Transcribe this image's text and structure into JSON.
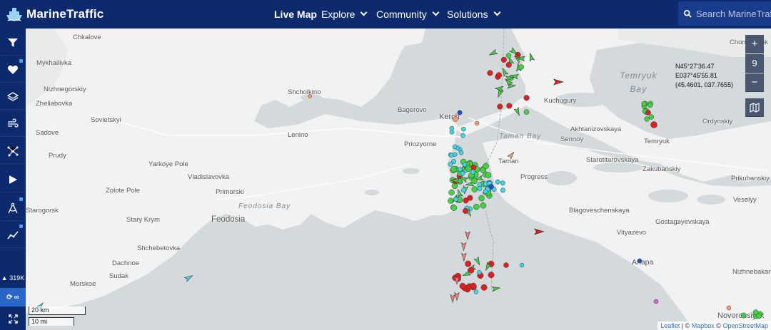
{
  "brand": {
    "name": "MarineTraffic"
  },
  "nav": {
    "live_map": "Live Map",
    "explore": "Explore",
    "community": "Community",
    "solutions": "Solutions"
  },
  "search": {
    "placeholder": "Search MarineTraffic"
  },
  "sidebar": {
    "items": [
      {
        "icon": "filter-icon"
      },
      {
        "icon": "heart-icon"
      },
      {
        "icon": "layers-icon"
      },
      {
        "icon": "wind-icon"
      },
      {
        "icon": "network-icon"
      },
      {
        "icon": "play-icon"
      },
      {
        "icon": "compass-icon"
      },
      {
        "icon": "chart-icon"
      }
    ],
    "vessel_count": "319K",
    "live_label": "∞",
    "expand_icon": "expand-icon"
  },
  "map": {
    "zoom": "9",
    "coordinates": {
      "lat": "N45°27'36.47",
      "lon": "E037°45'55.81",
      "decimal": "(45.4601, 037.7655)"
    },
    "scale": {
      "km": "20 km",
      "mi": "10 mi"
    },
    "attribution": {
      "leaflet": "Leaflet",
      "mapbox": "Mapbox",
      "osm": "OpenStreetMap",
      "sep": "|",
      "copy": "©"
    },
    "places": [
      {
        "name": "Chkalove"
      },
      {
        "name": "Mykhailivka"
      },
      {
        "name": "Nizhnegorskiy"
      },
      {
        "name": "Zheliabovka"
      },
      {
        "name": "Sovietskyi"
      },
      {
        "name": "Sadove"
      },
      {
        "name": "Prudy"
      },
      {
        "name": "Yarkoye Pole"
      },
      {
        "name": "Vladislavovka"
      },
      {
        "name": "Zolote Pole"
      },
      {
        "name": "Primorski"
      },
      {
        "name": "Lenino"
      },
      {
        "name": "Feodosia"
      },
      {
        "name": "Stary Krym"
      },
      {
        "name": "Shchebetovka"
      },
      {
        "name": "Dachnoe"
      },
      {
        "name": "Sudak"
      },
      {
        "name": "Morskoe"
      },
      {
        "name": "Shcholkino"
      },
      {
        "name": "Bagerovo"
      },
      {
        "name": "Kerch"
      },
      {
        "name": "Priozyorne"
      },
      {
        "name": "Kuchugury"
      },
      {
        "name": "Akhtanizovskaya"
      },
      {
        "name": "Sennoy"
      },
      {
        "name": "Taman"
      },
      {
        "name": "Starotitarovskaya"
      },
      {
        "name": "Temryuk"
      },
      {
        "name": "Progress"
      },
      {
        "name": "Zakubanskiy"
      },
      {
        "name": "Prikubanskiy"
      },
      {
        "name": "Chorny Yerik"
      },
      {
        "name": "Ordynskiy"
      },
      {
        "name": "Blagoveschenskaya"
      },
      {
        "name": "Gostagayevskaya"
      },
      {
        "name": "Vityazevo"
      },
      {
        "name": "Anapa"
      },
      {
        "name": "Veselyy"
      },
      {
        "name": "Nizhnebakansk"
      },
      {
        "name": "Novorossiysk"
      },
      {
        "name": "Starogorsk"
      }
    ],
    "water": [
      {
        "name": "Temryuk Bay"
      },
      {
        "name": "Taman Bay"
      },
      {
        "name": "Feodosia Bay"
      }
    ]
  },
  "colors": {
    "navbar": "#0e2a6e",
    "land": "#f2f2f2",
    "sea": "#d4dadc",
    "vessel_red": "#e02020",
    "vessel_green": "#45d045",
    "vessel_cyan": "#3fd7e8",
    "vessel_blue": "#1f50d0",
    "vessel_orange": "#f0a070"
  }
}
